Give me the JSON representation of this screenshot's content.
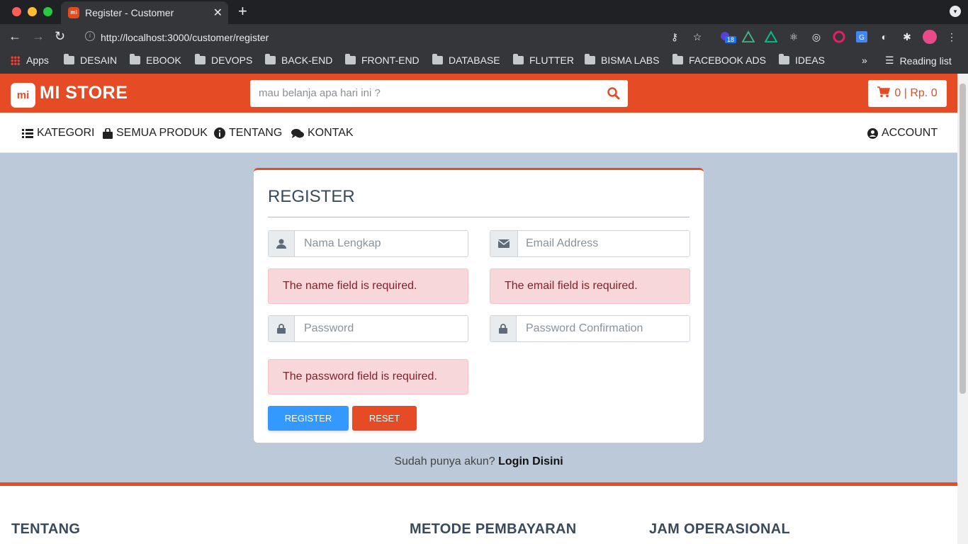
{
  "browser": {
    "tab_title": "Register - Customer",
    "tab_favicon": "mi",
    "url_host": "http://localhost:3000/customer/register",
    "extension_badge": "18",
    "bookmarks": [
      "Apps",
      "DESAIN",
      "EBOOK",
      "DEVOPS",
      "BACK-END",
      "FRONT-END",
      "DATABASE",
      "FLUTTER",
      "BISMA LABS",
      "FACEBOOK ADS",
      "IDEAS"
    ],
    "reading_list": "Reading list",
    "more": "»"
  },
  "header": {
    "logo_text": "mi",
    "store_name": "MI STORE",
    "search_placeholder": "mau belanja apa hari ini ?",
    "cart": "0 | Rp. 0"
  },
  "nav": {
    "kategori": "KATEGORI",
    "semua_produk": "SEMUA PRODUK",
    "tentang": "TENTANG",
    "kontak": "KONTAK",
    "account": "ACCOUNT"
  },
  "form": {
    "title": "REGISTER",
    "name_placeholder": "Nama Lengkap",
    "email_placeholder": "Email Address",
    "password_placeholder": "Password",
    "password_confirm_placeholder": "Password Confirmation",
    "name_error": "The name field is required.",
    "email_error": "The email field is required.",
    "password_error": "The password field is required.",
    "register_button": "REGISTER",
    "reset_button": "RESET"
  },
  "login_prompt": {
    "text": "Sudah punya akun?",
    "link": "Login Disini"
  },
  "footer": {
    "tentang": "TENTANG",
    "metode_pembayaran": "METODE PEMBAYARAN",
    "jam_operasional": "JAM OPERASIONAL"
  },
  "colors": {
    "brand": "#e54b24",
    "page_bg": "#bcc9d8",
    "register_button": "#3399ff",
    "alert_bg": "#f8d7da"
  }
}
